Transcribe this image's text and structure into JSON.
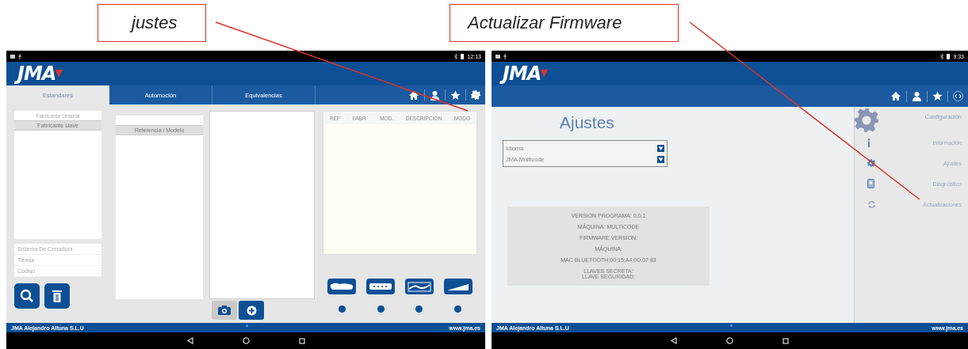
{
  "callouts": [
    {
      "text": "justes"
    },
    {
      "text": "Actualizar Firmware"
    }
  ],
  "screens": [
    {
      "kind": "search",
      "status_time": "12:13",
      "logo": "JMA",
      "tabs": [
        {
          "label": "Estandares",
          "selected": true
        },
        {
          "label": "Automoción",
          "selected": false
        },
        {
          "label": "Equivalencias",
          "selected": false
        }
      ],
      "manufacturer_placeholder": "Fabricante Original",
      "manufacturer_header": "Fabricante Llave",
      "filters": [
        {
          "placeholder": "Sistema De Cerradura"
        },
        {
          "placeholder": "Tienda"
        },
        {
          "placeholder": "Código"
        }
      ],
      "reference_header": "Referencia / Modelo",
      "result_columns": [
        "REF",
        "FABR.",
        "MOD.",
        "DESCRIPCION",
        "MODO"
      ],
      "footer": {
        "company": "JMA Alejandro Altuna S.L.U",
        "website": "www.jma.es"
      }
    },
    {
      "kind": "settings",
      "status_time": "9:33",
      "logo": "JMA",
      "title": "Ajustes",
      "dropdowns": [
        {
          "value": "Idioma"
        },
        {
          "value": "JMA Multicode"
        }
      ],
      "info_lines": [
        "VERSION PROGRAMA: 0.0.1",
        "MÁQUINA: MULTICODE",
        "FIRMWARE VERSION:",
        "MÁQUINA:",
        "MAC BLUETOOTH:00:15:A4:0D:07:83",
        "LLAVES SECRETA:\nLLAVE SEGURIDAD:"
      ],
      "menu_title": "Configuración",
      "menu": [
        {
          "label": "Información",
          "kind": "info"
        },
        {
          "label": "Ajustes",
          "kind": "settings"
        },
        {
          "label": "Diagnóstico",
          "kind": "diagnostic"
        },
        {
          "label": "Actualizaciones",
          "kind": "update"
        }
      ],
      "footer": {
        "company": "JMA Alejandro Altuna S.L.U",
        "website": "www.jma.es"
      }
    }
  ]
}
